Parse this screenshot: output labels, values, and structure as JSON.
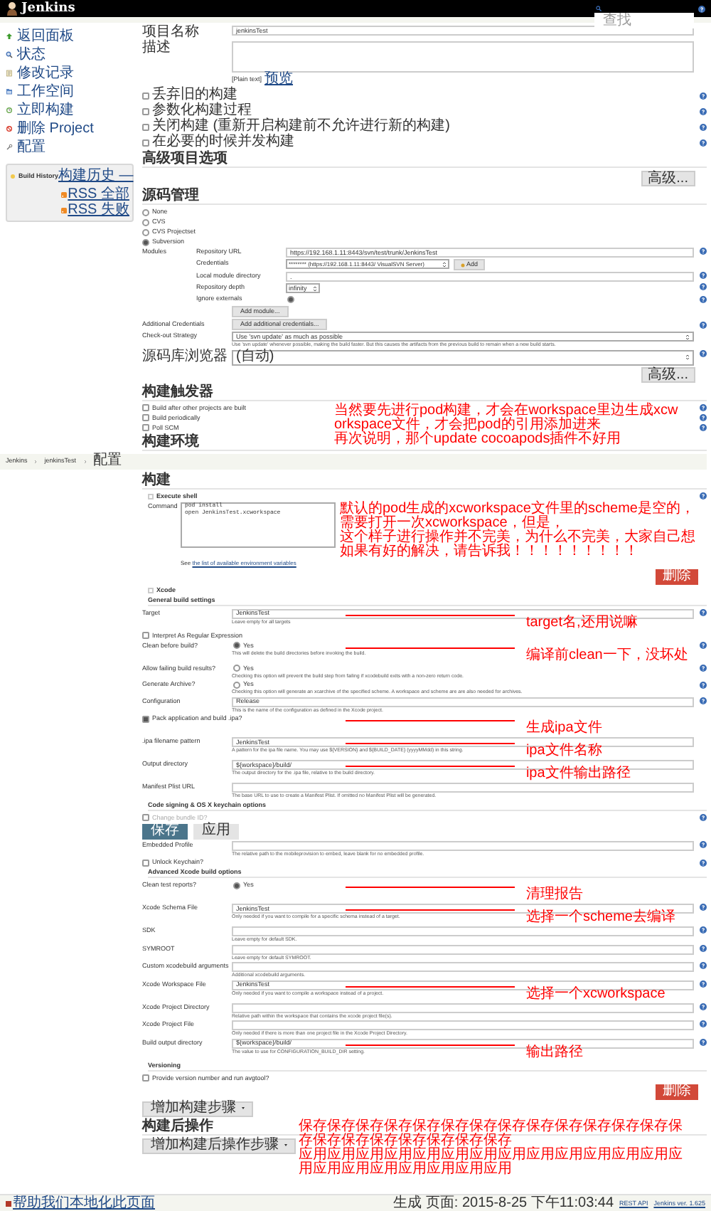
{
  "header": {
    "logo": "Jenkins",
    "search": {
      "placeholder": "查找"
    }
  },
  "sidebar": {
    "items": [
      "返回面板",
      "状态",
      "修改记录",
      "工作空间",
      "立即构建",
      "删除 Project",
      "配置"
    ],
    "build_history": {
      "title": "Build History",
      "trend": "构建历史 —",
      "feeds": [
        "RSS 全部",
        "RSS 失败"
      ]
    }
  },
  "form": [
    {
      "kind": "field",
      "label": "项目名称",
      "value": "jenkinsTest",
      "help_button": false
    },
    {
      "kind": "textarea",
      "label": "描述",
      "note": "[Plain text]",
      "link": "预览"
    },
    {
      "kind": "checkbox",
      "label": "丢弃旧的构建",
      "checked": false,
      "help_button": true
    },
    {
      "kind": "checkbox",
      "label": "参数化构建过程",
      "checked": false,
      "help_button": true
    },
    {
      "kind": "checkbox",
      "label": "关闭构建 (重新开启构建前不允许进行新的构建)",
      "checked": false,
      "help_button": true
    },
    {
      "kind": "checkbox",
      "label": "在必要的时候并发构建",
      "checked": false,
      "help_button": true
    },
    {
      "kind": "section",
      "title": "高级项目选项"
    },
    {
      "kind": "button",
      "label": "高级..."
    },
    {
      "kind": "section",
      "title": "源码管理"
    },
    {
      "kind": "radio",
      "label": "None",
      "selected": false
    },
    {
      "kind": "radio",
      "label": "CVS",
      "selected": false
    },
    {
      "kind": "radio",
      "label": "CVS Projectset",
      "selected": false
    },
    {
      "kind": "radio",
      "label": "Subversion",
      "selected": true
    },
    {
      "kind": "group",
      "label": "Modules",
      "rows": [
        {
          "kind": "field",
          "label": "Repository URL",
          "value": "https://192.168.1.11:8443/svn/test/trunk/JenkinsTest",
          "help_button": true
        },
        {
          "kind": "credentials",
          "label": "Credentials",
          "value": "******** (https://192.168.1.11:8443/ VisualSVN Server)",
          "button": "Add"
        },
        {
          "kind": "field",
          "label": "Local module directory",
          "value": ".",
          "help_button": true
        },
        {
          "kind": "small_select",
          "label": "Repository depth",
          "value": "infinity",
          "help_button": true
        },
        {
          "kind": "checkbox_field",
          "label": "Ignore externals",
          "checked": true,
          "help_button": true
        }
      ]
    },
    {
      "kind": "button_row",
      "button": "Add module...",
      "help_button": false
    },
    {
      "kind": "button_row",
      "label": "Additional Credentials",
      "button": "Add additional credentials...",
      "help_button": true
    },
    {
      "kind": "select",
      "label": "Check-out Strategy",
      "value": "Use 'svn update' as much as possible",
      "help": "Use 'svn update' whenever possible, making the build faster. But this causes the artifacts from the previous build to remain when a new build starts.",
      "help_button": false
    },
    {
      "kind": "select",
      "label": "源码库浏览器",
      "value": "(自动)",
      "help_button": true
    },
    {
      "kind": "button",
      "label": "高级..."
    },
    {
      "kind": "section",
      "title": "构建触发器"
    },
    {
      "kind": "checkbox",
      "label": "Build after other projects are built",
      "checked": false,
      "help_button": true,
      "callout": [
        "当然要先进行pod构建，才会在workspace里边生成xcworkspace文件，才会把pod的引用添加进来",
        "再次说明，那个update cocoapods插件不好用"
      ]
    },
    {
      "kind": "checkbox",
      "label": "Build periodically",
      "checked": false,
      "help_button": true
    },
    {
      "kind": "checkbox",
      "label": "Poll SCM",
      "checked": false,
      "help_button": true
    },
    {
      "kind": "section",
      "title": "构建环境"
    },
    {
      "kind": "breadcrumb",
      "items": [
        "Jenkins",
        "jenkinsTest",
        "配置"
      ]
    },
    {
      "kind": "section",
      "title": "构建"
    },
    {
      "kind": "step_title",
      "title": "Execute shell",
      "help_button": true
    },
    {
      "kind": "code",
      "label": "Command",
      "lines": [
        "pod install",
        "open JenkinsTest.xcworkspace"
      ],
      "callout": [
        "默认的pod生成的xcworkspace文件里的scheme是空的，需要打开一次xcworkspace，但是，",
        "这个样子进行操作并不完美，为什么不完美，大家自己想",
        "如果有好的解决，请告诉我！！！！！！！！！"
      ]
    },
    {
      "kind": "note",
      "text": "See ",
      "link": "the list of available environment variables"
    },
    {
      "kind": "delete_button",
      "label": "删除"
    },
    {
      "kind": "step_title",
      "title": "Xcode",
      "help_button": false
    },
    {
      "kind": "subsection",
      "title": "General build settings"
    },
    {
      "kind": "field",
      "label": "Target",
      "value": "JenkinsTest",
      "help": "Leave empty for all targets",
      "help_button": true,
      "annotation": "target名,还用说嘛"
    },
    {
      "kind": "checkbox",
      "label": "Interpret As Regular Expression",
      "checked": false,
      "help_button": false
    },
    {
      "kind": "yes",
      "label": "Clean before build?",
      "option": "Yes",
      "checked": true,
      "help": "This will delete the build directories before invoking the build.",
      "help_button": true,
      "annotation": "编译前clean一下，没坏处"
    },
    {
      "kind": "yes",
      "label": "Allow failing build results?",
      "option": "Yes",
      "checked": false,
      "help": "Checking this option will prevent the build step from failing if xcodebuild exits with a non-zero return code.",
      "help_button": true
    },
    {
      "kind": "yes",
      "label": "Generate Archive?",
      "option": "Yes",
      "checked": false,
      "help": "Checking this option will generate an xcarchive of the specified scheme. A workspace and scheme are are also needed for archives.",
      "help_button": true
    },
    {
      "kind": "field",
      "label": "Configuration",
      "value": "Release",
      "help": "This is the name of the configuration as defined in the Xcode project.",
      "help_button": true
    },
    {
      "kind": "checkbox",
      "label": "Pack application and build .ipa?",
      "checked": true,
      "help_button": false,
      "annotation": "生成ipa文件"
    },
    {
      "kind": "field",
      "label": ".ipa filename pattern",
      "value": "JenkinsTest",
      "help": "A pattern for the ipa file name. You may use ${VERSION} and ${BUILD_DATE} (yyyyMMdd) in this string.",
      "help_button": false,
      "annotation": "ipa文件名称"
    },
    {
      "kind": "field",
      "label": "Output directory",
      "value": "${workspace}/build/",
      "help": "The output directory for the .ipa file, relative to the build directory.",
      "help_button": false,
      "annotation": "ipa文件输出路径"
    },
    {
      "kind": "field",
      "label": "Manifest Plist URL",
      "help": "The base URL to use to create a Manifest Plist. If omitted no Manifest Plist will be generated.",
      "help_button": false
    },
    {
      "kind": "subsection",
      "title": "Code signing & OS X keychain options"
    },
    {
      "kind": "checkbox",
      "label": "Change bundle ID?",
      "checked": false,
      "help_button": true,
      "disabled": true
    },
    {
      "kind": "save_bar",
      "buttons": [
        "保存",
        "应用"
      ]
    },
    {
      "kind": "field",
      "label": "Embedded Profile",
      "help": "The relative path to the mobileprovision to embed, leave blank for no embedded profile.",
      "help_button": true
    },
    {
      "kind": "checkbox",
      "label": "Unlock Keychain?",
      "checked": false,
      "help_button": true
    },
    {
      "kind": "subsection",
      "title": "Advanced Xcode build options"
    },
    {
      "kind": "yes",
      "label": "Clean test reports?",
      "option": "Yes",
      "checked": true,
      "help_button": false,
      "annotation": "清理报告"
    },
    {
      "kind": "field",
      "label": "Xcode Schema File",
      "value": "JenkinsTest",
      "help": "Only needed if you want to compile for a specific schema instead of a target.",
      "help_button": true,
      "annotation": "选择一个scheme去编译"
    },
    {
      "kind": "field",
      "label": "SDK",
      "help": "Leave empty for default SDK.",
      "help_button": true
    },
    {
      "kind": "field",
      "label": "SYMROOT",
      "help": "Leave empty for default SYMROOT.",
      "help_button": true
    },
    {
      "kind": "field",
      "label": "Custom xcodebuild arguments",
      "help": "Additional xcodebuild arguments.",
      "help_button": true
    },
    {
      "kind": "field",
      "label": "Xcode Workspace File",
      "value": "JenkinsTest",
      "help": "Only needed if you want to compile a workspace instead of a project.",
      "help_button": true,
      "annotation": "选择一个xcworkspace"
    },
    {
      "kind": "field",
      "label": "Xcode Project Directory",
      "help": "Relative path within the workspace that contains the xcode project file(s).",
      "help_button": true
    },
    {
      "kind": "field",
      "label": "Xcode Project File",
      "help": "Only needed if there is more than one project file in the Xcode Project Directory.",
      "help_button": true
    },
    {
      "kind": "field",
      "label": "Build output directory",
      "value": "${workspace}/build/",
      "help": "The value to use for CONFIGURATION_BUILD_DIR setting.",
      "help_button": true,
      "annotation": "输出路径"
    },
    {
      "kind": "subsection",
      "title": "Versioning"
    },
    {
      "kind": "checkbox",
      "label": "Provide version number and run avgtool?",
      "checked": false,
      "help_button": false
    },
    {
      "kind": "delete_button",
      "label": "删除"
    },
    {
      "kind": "dropdown_button",
      "label": "增加构建步骤"
    },
    {
      "kind": "section",
      "title": "构建后操作",
      "callout": [
        "保存保存保存保存保存保存保存保存保存保存保存保存保存保存保存保存保存保存保存保存保存",
        "应用应用应用应用应用应用应用应用应用应用应用应用应用应用应用应用应用应用应用应用应用"
      ]
    },
    {
      "kind": "dropdown_button",
      "label": "增加构建后操作步骤"
    }
  ],
  "footer": {
    "link": "帮助我们本地化此页面",
    "generated": "生成 页面: 2015-8-25 下午11:03:44",
    "links": [
      "REST API",
      "Jenkins ver. 1.625"
    ]
  }
}
